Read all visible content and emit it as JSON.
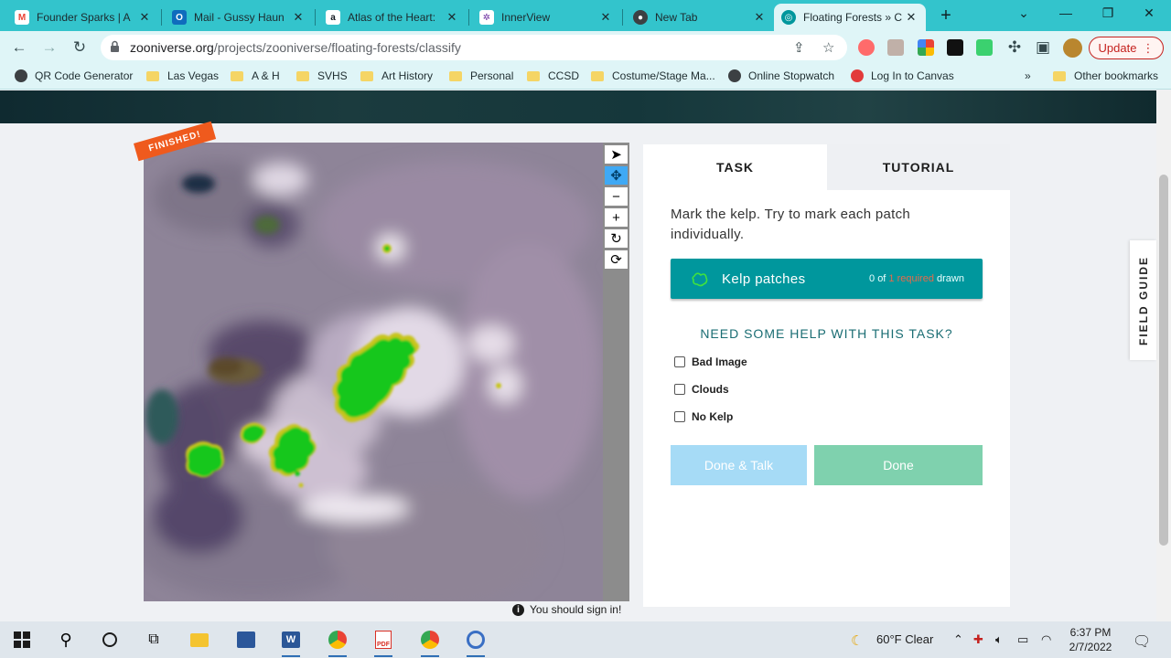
{
  "browser": {
    "tabs": [
      {
        "title": "Founder Sparks | A",
        "icon": "gmail-icon",
        "color": "#ea4335"
      },
      {
        "title": "Mail - Gussy Haun",
        "icon": "outlook-icon",
        "color": "#0f6cbd"
      },
      {
        "title": "Atlas of the Heart: ",
        "icon": "amazon-icon",
        "color": "#131921"
      },
      {
        "title": "InnerView",
        "icon": "innerview-icon",
        "color": "#6b2fa0"
      },
      {
        "title": "New Tab",
        "icon": "chrome-icon",
        "color": "#3c4043"
      },
      {
        "title": "Floating Forests » C",
        "icon": "zooniverse-icon",
        "color": "#00979d",
        "active": true
      }
    ],
    "url_host": "zooniverse.org",
    "url_path": "/projects/zooniverse/floating-forests/classify",
    "update_label": "Update",
    "bookmarks": [
      {
        "label": "QR Code Generator",
        "type": "globe"
      },
      {
        "label": "Las Vegas",
        "type": "folder"
      },
      {
        "label": "A & H",
        "type": "folder"
      },
      {
        "label": "SVHS",
        "type": "folder"
      },
      {
        "label": "Art History",
        "type": "folder"
      },
      {
        "label": "Personal",
        "type": "folder"
      },
      {
        "label": "CCSD",
        "type": "folder"
      },
      {
        "label": "Costume/Stage Ma...",
        "type": "folder"
      },
      {
        "label": "Online Stopwatch",
        "type": "globe"
      },
      {
        "label": "Log In to Canvas",
        "type": "canvas"
      }
    ],
    "overflow_label": "»",
    "other_bookmarks": "Other bookmarks"
  },
  "classifier": {
    "ribbon": "FINISHED!",
    "signin_notice": "You should sign in!",
    "tools": [
      "pointer-icon",
      "move-icon",
      "zoom-out-icon",
      "zoom-in-icon",
      "rotate-icon",
      "reset-icon"
    ]
  },
  "panel": {
    "tab_task": "TASK",
    "tab_tutorial": "TUTORIAL",
    "instruction": "Mark the kelp. Try to mark each patch individually.",
    "tool_label": "Kelp patches",
    "count_prefix": "0 of ",
    "count_required": "1 required",
    "count_suffix": " drawn",
    "help_heading": "NEED SOME HELP WITH THIS TASK?",
    "options": [
      "Bad Image",
      "Clouds",
      "No Kelp"
    ],
    "done_talk": "Done & Talk",
    "done": "Done",
    "field_guide": "FIELD GUIDE"
  },
  "taskbar": {
    "weather": "60°F  Clear",
    "time": "6:37 PM",
    "date": "2/7/2022"
  },
  "colors": {
    "teal": "#00979d",
    "tab_strip": "#33c4cc",
    "kelp_green": "#1ec81e",
    "finished_orange": "#ef5a1d"
  }
}
